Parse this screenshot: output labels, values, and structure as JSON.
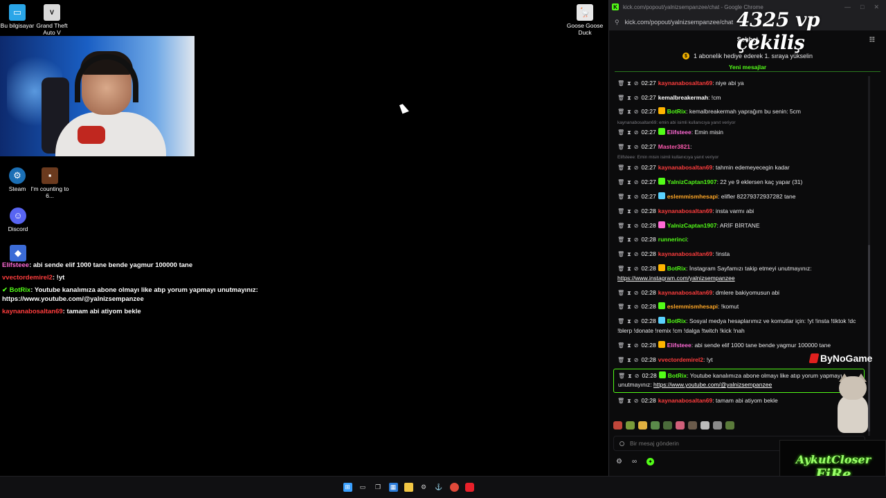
{
  "desktop": {
    "icons": [
      {
        "label": "Bu bilgisayar",
        "icon": "computer-icon",
        "color": "#2aa6e8"
      },
      {
        "label": "Grand Theft Auto V",
        "icon": "gta-icon",
        "color": "#d9d9d9"
      },
      {
        "label": "Goose Goose Duck",
        "icon": "goose-icon",
        "color": "#e7e7e7"
      },
      {
        "label": "Steam",
        "icon": "steam-icon",
        "color": "#1b6fb5"
      },
      {
        "label": "I'm counting to 6...",
        "icon": "game-icon",
        "color": "#6b3a1e"
      },
      {
        "label": "Discord",
        "icon": "discord-icon",
        "color": "#5865f2"
      },
      {
        "label": "",
        "icon": "roblox-icon",
        "color": "#3b6bd6"
      }
    ]
  },
  "overlay_chat": [
    {
      "user": "Elifsteee",
      "color": "#ff6ad5",
      "text": ": abi sende elif 1000 tane bende yagmur 100000 tane"
    },
    {
      "user": "vvectordemirel2",
      "color": "#ff3d3d",
      "text": ": !yt"
    },
    {
      "user": "BotRix",
      "color": "#53fc18",
      "text": ": Youtube kanalımıza abone olmayı like atıp yorum yapmayı unutmayınız:",
      "text2": "https://www.youtube.com/@yalnizsempanzee"
    },
    {
      "user": "kaynanabosaltan69",
      "color": "#ff3d3d",
      "text": ": tamam abi atiyom bekle"
    }
  ],
  "browser": {
    "title": "kick.com/popout/yalnizsempanzee/chat - Google Chrome",
    "url": "kick.com/popout/yalnizsempanzee/chat",
    "chat_title": "Sohbet",
    "pinned": "1 abonelik hediye ederek 1. sıraya yükselin",
    "new_messages": "Yeni mesajlar",
    "input_placeholder": "Bir mesaj gönderin",
    "brand_color": "#53fc18"
  },
  "messages": [
    {
      "time": "02:27",
      "user": "kaynanabosaltan69",
      "color": "#ff3d3d",
      "text": ": niye abi ya"
    },
    {
      "time": "02:27",
      "user": "kemalbreakermah",
      "color": "#ffffff",
      "text": ": !cm"
    },
    {
      "time": "02:27",
      "user": "BotRix",
      "color": "#53fc18",
      "text": ": kemalbreakermah yaprağım bu senin: 5cm"
    },
    {
      "reply": "kaynanabosaltan69: emin abi isimli kullanıcıya yanıt veriyor"
    },
    {
      "time": "02:27",
      "user": "Elifsteee",
      "color": "#ff6ad5",
      "text": ": Emin misin"
    },
    {
      "time": "02:27",
      "user": "Master3821",
      "color": "#ff5ab0",
      "text": ":"
    },
    {
      "reply": "Elifsteee: Emin misin isimli kullanıcıya yanıt veriyor"
    },
    {
      "time": "02:27",
      "user": "kaynanabosaltan69",
      "color": "#ff3d3d",
      "text": ": tahmin edemeyecegin kadar"
    },
    {
      "time": "02:27",
      "user": "YalnizCaptan1907",
      "color": "#53fc18",
      "text": ": 22 ye 9 eklersen kaç yapar (31)"
    },
    {
      "time": "02:27",
      "user": "eslemmismhesapi",
      "color": "#ffa726",
      "text": ": elifler 82279372937282 tane"
    },
    {
      "time": "02:28",
      "user": "kaynanabosaltan69",
      "color": "#ff3d3d",
      "text": ": insta varmı abi"
    },
    {
      "time": "02:28",
      "user": "YalnizCaptan1907",
      "color": "#53fc18",
      "text": ": ARİF BİRTANE"
    },
    {
      "time": "02:28",
      "user": "runnerinci",
      "color": "#53fc18",
      "text": ":"
    },
    {
      "time": "02:28",
      "user": "kaynanabosaltan69",
      "color": "#ff3d3d",
      "text": ": !insta"
    },
    {
      "time": "02:28",
      "user": "BotRix",
      "color": "#53fc18",
      "text": ": İnstagram Sayfamızı takip etmeyi unutmayınız:",
      "link": "https://www.instagram.com/yalnizsempanzee"
    },
    {
      "time": "02:28",
      "user": "kaynanabosaltan69",
      "color": "#ff3d3d",
      "text": ": dmlere bakiyomusun abi"
    },
    {
      "time": "02:28",
      "user": "eslemmismhesapi",
      "color": "#ffa726",
      "text": ": !komut"
    },
    {
      "time": "02:28",
      "user": "BotRix",
      "color": "#53fc18",
      "text": ": Sosyal medya hesaplarımız ve komutlar için: !yt !insta !tiktok !dc !blerp !donate !remix !cm !dalga !twitch !kick !nah"
    },
    {
      "time": "02:28",
      "user": "Elifsteee",
      "color": "#ff6ad5",
      "text": ": abi sende elif 1000 tane bende yagmur 100000 tane"
    },
    {
      "time": "02:28",
      "user": "vvectordemirel2",
      "color": "#ff3d3d",
      "text": ": !yt"
    },
    {
      "time": "02:28",
      "user": "BotRix",
      "color": "#53fc18",
      "text": ": Youtube kanalımıza abone olmayı like atıp yorum yapmayı unutmayınız:",
      "link": "https://www.youtube.com/@yalnizsempanzee",
      "highlight": true
    },
    {
      "time": "02:28",
      "user": "kaynanabosaltan69",
      "color": "#ff3d3d",
      "text": ": tamam abi atiyom bekle"
    }
  ],
  "overlays": {
    "giveaway": "4325 vp çekiliş",
    "sponsor": "ByNoGame",
    "logo_line1": "AykutCloser",
    "logo_line2": "FiRe"
  }
}
